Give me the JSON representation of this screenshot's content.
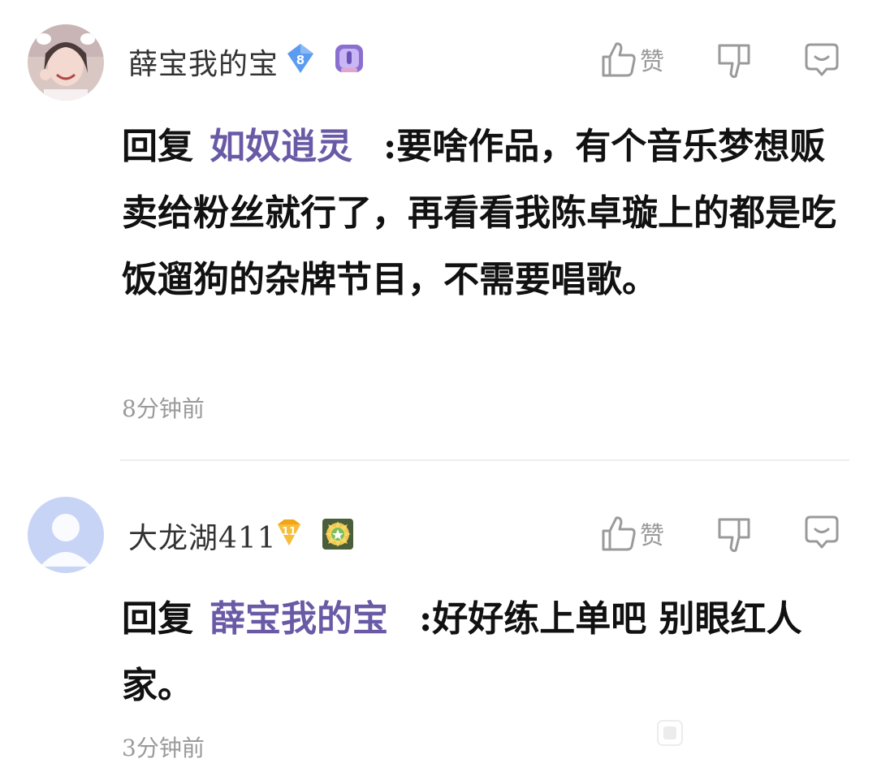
{
  "comments": [
    {
      "username": "薛宝我的宝",
      "level": "8",
      "like_label": "赞",
      "reply_prefix": "回复",
      "reply_target": "如奴逍灵",
      "text": ":要啥作品，有个音乐梦想贩卖给粉丝就行了，再看看我陈卓璇上的都是吃饭遛狗的杂牌节目，不需要唱歌。",
      "time": "8分钟前",
      "level_color": "#5b9bf0",
      "avatar": "user-photo-avatar"
    },
    {
      "username": "大龙湖411",
      "level": "11",
      "like_label": "赞",
      "reply_prefix": "回复",
      "reply_target": "薛宝我的宝",
      "text": ":好好练上单吧 别眼红人家。",
      "time": "3分钟前",
      "level_color": "#f2a516",
      "avatar": "default-avatar"
    }
  ],
  "colors": {
    "reply_target": "#6a5aa6",
    "meta_text": "#9a9a9a",
    "body_text": "#111111"
  }
}
